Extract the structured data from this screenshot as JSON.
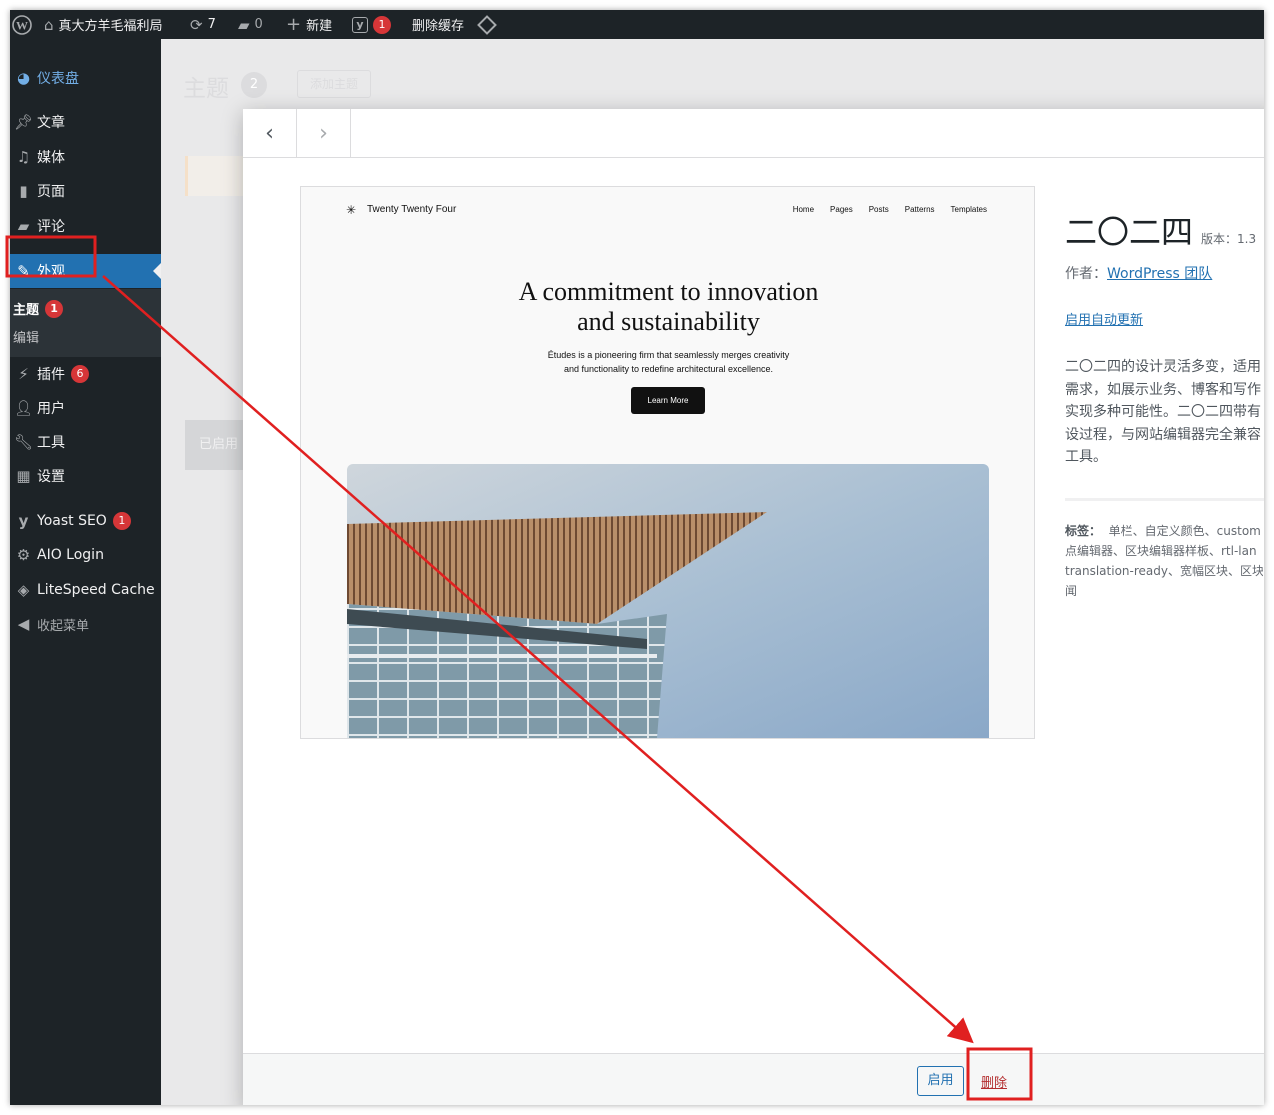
{
  "adminbar": {
    "site_name": "真大方羊毛福利局",
    "updates_count": "7",
    "comments_count": "0",
    "new_label": "新建",
    "yoast_count": "1",
    "purge_label": "删除缓存"
  },
  "sidebar": {
    "items": [
      {
        "label": "仪表盘",
        "icon": "dashboard-icon"
      },
      {
        "label": "文章",
        "icon": "pin-icon"
      },
      {
        "label": "媒体",
        "icon": "media-icon"
      },
      {
        "label": "页面",
        "icon": "page-icon"
      },
      {
        "label": "评论",
        "icon": "comment-icon"
      },
      {
        "label": "外观",
        "icon": "brush-icon"
      },
      {
        "label": "插件",
        "icon": "plugin-icon",
        "badge": "6"
      },
      {
        "label": "用户",
        "icon": "user-icon"
      },
      {
        "label": "工具",
        "icon": "wrench-icon"
      },
      {
        "label": "设置",
        "icon": "settings-icon"
      },
      {
        "label": "Yoast SEO",
        "icon": "yoast-icon",
        "badge": "1"
      },
      {
        "label": "AIO Login",
        "icon": "gear-icon"
      },
      {
        "label": "LiteSpeed Cache",
        "icon": "litespeed-icon"
      },
      {
        "label": "收起菜单",
        "icon": "collapse-icon"
      }
    ],
    "submenu": [
      {
        "label": "主题",
        "badge": "1"
      },
      {
        "label": "编辑"
      }
    ]
  },
  "background_page": {
    "title": "主题",
    "count": "2",
    "add_button": "添加主题",
    "active_label": "已启用"
  },
  "modal": {
    "screenshot": {
      "site_title": "Twenty Twenty Four",
      "nav": [
        "Home",
        "Pages",
        "Posts",
        "Patterns",
        "Templates"
      ],
      "headline_line1": "A commitment to innovation",
      "headline_line2": "and sustainability",
      "paragraph_line1": "Études is a pioneering firm that seamlessly merges creativity",
      "paragraph_line2": "and functionality to redefine architectural excellence.",
      "button": "Learn More"
    },
    "theme_name": "二〇二四",
    "version": "版本：1.3",
    "author_label": "作者：",
    "author_name": "WordPress 团队",
    "auto_update": "启用自动更新",
    "description_lines": [
      "二〇二四的设计灵活多变，适用",
      "需求，如展示业务、博客和写作",
      "实现多种可能性。二〇二四带有",
      "设过程，与网站编辑器完全兼容",
      "工具。"
    ],
    "tags_label": "标签：",
    "tags_lines": [
      "单栏、自定义颜色、custom",
      "点编辑器、区块编辑器样板、rtl-lan",
      "translation-ready、宽幅区块、区块",
      "闻"
    ],
    "activate_button": "启用",
    "delete_link": "删除"
  },
  "colors": {
    "admin_dark": "#1d2327",
    "wp_blue": "#2271b1",
    "badge_red": "#d63638",
    "annotation_red": "#e02020"
  }
}
